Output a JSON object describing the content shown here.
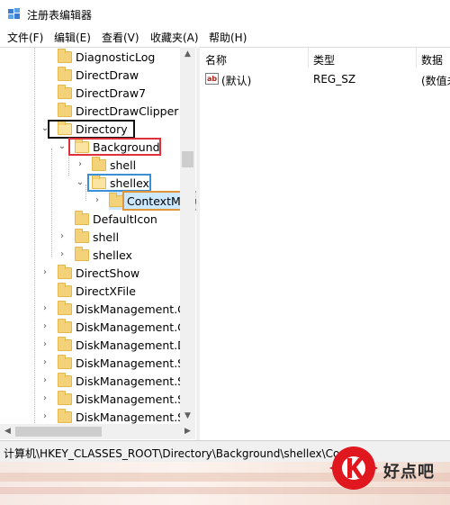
{
  "window": {
    "title": "注册表编辑器"
  },
  "menu": [
    "文件(F)",
    "编辑(E)",
    "查看(V)",
    "收藏夹(A)",
    "帮助(H)"
  ],
  "tree": [
    {
      "label": "DiagnosticLog"
    },
    {
      "label": "DirectDraw"
    },
    {
      "label": "DirectDraw7"
    },
    {
      "label": "DirectDrawClipper"
    },
    {
      "label": "Directory"
    },
    {
      "label": "Background"
    },
    {
      "label": "shell"
    },
    {
      "label": "shellex"
    },
    {
      "label": "ContextMenuHandlers"
    },
    {
      "label": "DefaultIcon"
    },
    {
      "label": "shell"
    },
    {
      "label": "shellex"
    },
    {
      "label": "DirectShow"
    },
    {
      "label": "DirectXFile"
    },
    {
      "label": "DiskManagement.C"
    },
    {
      "label": "DiskManagement.C"
    },
    {
      "label": "DiskManagement.D"
    },
    {
      "label": "DiskManagement.Sı"
    },
    {
      "label": "DiskManagement.Sı"
    },
    {
      "label": "DiskManagement.Sı"
    },
    {
      "label": "DiskManagement.Sı"
    }
  ],
  "list": {
    "columns": [
      "名称",
      "类型",
      "数据"
    ],
    "rows": [
      {
        "name": "(默认)",
        "type": "REG_SZ",
        "data": "(数值未"
      }
    ],
    "icon": "ab-string-icon"
  },
  "status": {
    "path": "计算机\\HKEY_CLASSES_ROOT\\Directory\\Background\\shellex\\Co"
  },
  "watermark": {
    "text": "好点吧",
    "color": "#e0171f"
  },
  "highlight_colors": {
    "black": "#111111",
    "red": "#e0303a",
    "blue": "#3a8fd6",
    "orange": "#e0953a"
  }
}
